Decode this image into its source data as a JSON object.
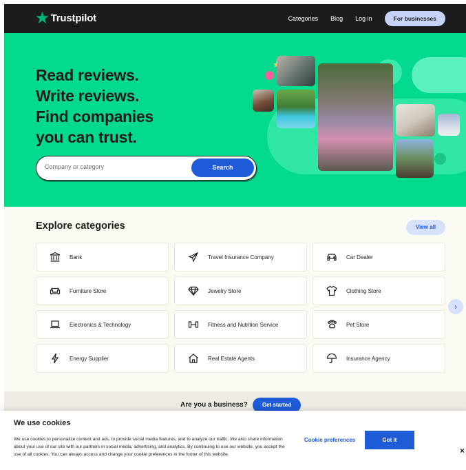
{
  "header": {
    "brand": "Trustpilot",
    "nav": [
      "Categories",
      "Blog",
      "Log in"
    ],
    "business_button": "For businesses"
  },
  "hero": {
    "headline": [
      "Read reviews.",
      "Write reviews.",
      "Find companies",
      "you can trust."
    ],
    "search_placeholder": "Company or category",
    "search_button": "Search"
  },
  "categories": {
    "title": "Explore categories",
    "view_all": "View all",
    "items": [
      {
        "label": "Bank",
        "icon": "bank-icon"
      },
      {
        "label": "Travel Insurance Company",
        "icon": "airplane-icon"
      },
      {
        "label": "Car Dealer",
        "icon": "car-icon"
      },
      {
        "label": "Furniture Store",
        "icon": "sofa-icon"
      },
      {
        "label": "Jewelry Store",
        "icon": "diamond-icon"
      },
      {
        "label": "Clothing Store",
        "icon": "shirt-icon"
      },
      {
        "label": "Electronics & Technology",
        "icon": "laptop-icon"
      },
      {
        "label": "Fitness and Nutrition Service",
        "icon": "dumbbell-icon"
      },
      {
        "label": "Pet Store",
        "icon": "paw-icon"
      },
      {
        "label": "Energy Supplier",
        "icon": "lightning-icon"
      },
      {
        "label": "Real Estate Agents",
        "icon": "house-icon"
      },
      {
        "label": "Insurance Agency",
        "icon": "umbrella-icon"
      }
    ]
  },
  "business": {
    "question": "Are you a business?",
    "cta": "Get started"
  },
  "cookie": {
    "title": "We use cookies",
    "text": "We use cookies to personalize content and ads, to provide social media features, and to analyze our traffic. We also share information about your use of our site with our partners in social media, advertising, and analytics. By continuing to use our website, you accept the use of all cookies. You can always access and change your cookie preferences in the footer of this website.",
    "preferences": "Cookie preferences",
    "accept": "Got it",
    "close": "×"
  },
  "colors": {
    "brand_green": "#04da8d",
    "star_green": "#00b67a",
    "accent_blue": "#1f5bd6",
    "light_blue": "#d6e1fb",
    "dark": "#1c1c1c"
  }
}
